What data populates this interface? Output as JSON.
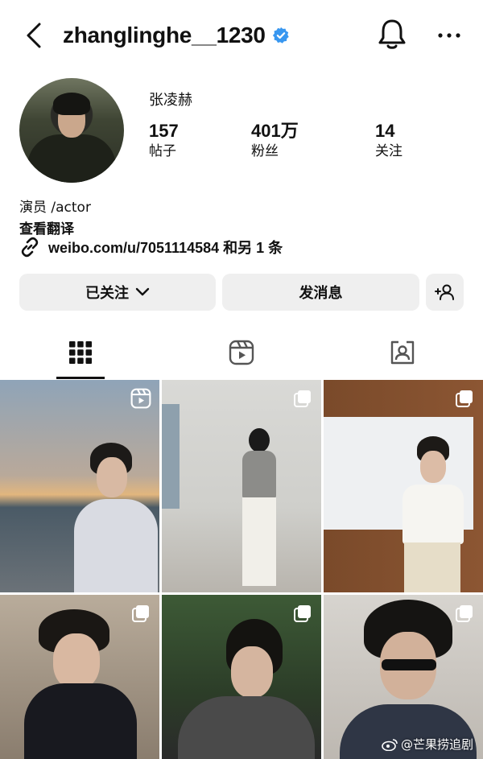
{
  "header": {
    "username": "zhanglinghe__1230",
    "verified": true,
    "icons": {
      "back": "chevron-left-icon",
      "bell": "bell-icon",
      "more": "more-dots-icon"
    }
  },
  "profile": {
    "display_name": "张凌赫",
    "stats": {
      "posts": {
        "value": "157",
        "label": "帖子"
      },
      "followers": {
        "value": "401万",
        "label": "粉丝"
      },
      "following": {
        "value": "14",
        "label": "关注"
      }
    },
    "bio": "演员 /actor",
    "translate": "查看翻译",
    "link": "weibo.com/u/7051114584 和另 1 条"
  },
  "actions": {
    "following_label": "已关注",
    "message_label": "发消息"
  },
  "tabs": [
    {
      "name": "posts-grid",
      "icon": "grid-icon",
      "active": true
    },
    {
      "name": "reels",
      "icon": "reels-icon",
      "active": false
    },
    {
      "name": "tagged",
      "icon": "tagged-icon",
      "active": false
    }
  ],
  "grid": [
    {
      "type": "reel"
    },
    {
      "type": "multi"
    },
    {
      "type": "multi"
    },
    {
      "type": "multi"
    },
    {
      "type": "multi"
    },
    {
      "type": "multi"
    }
  ],
  "watermark": "@芒果捞追剧",
  "colors": {
    "verified": "#3897f0",
    "button_bg": "#efefef"
  }
}
